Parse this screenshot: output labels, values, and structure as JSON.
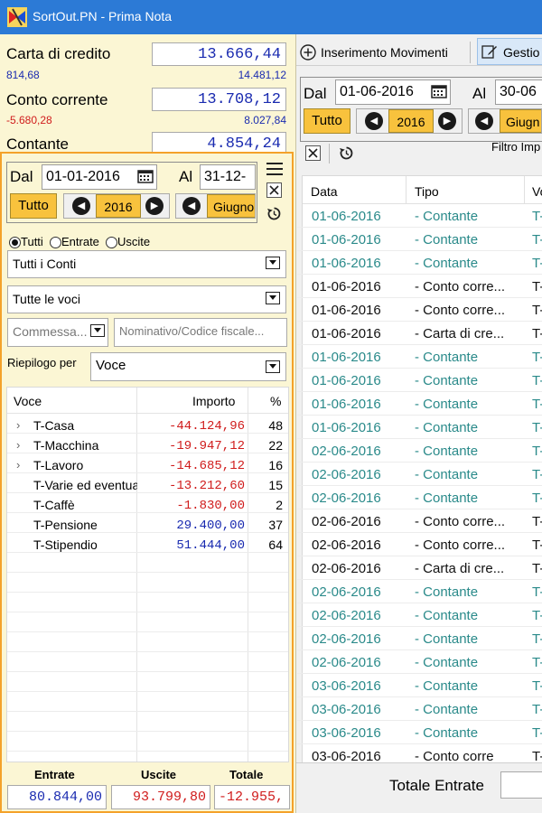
{
  "window": {
    "title": "SortOut.PN - Prima Nota"
  },
  "balances": [
    {
      "label": "Carta di credito",
      "amount": "13.666,44",
      "left_sub": "814,68",
      "left_sub_color": "#1a2bb0",
      "right_sub": "14.481,12"
    },
    {
      "label": "Conto corrente",
      "amount": "13.708,12",
      "left_sub": "-5.680,28",
      "left_sub_color": "#d01c1c",
      "right_sub": "8.027,84"
    },
    {
      "label": "Contante",
      "amount": "4.854,24"
    }
  ],
  "filter": {
    "dal_label": "Dal",
    "dal_value": "01-01-2016",
    "al_label": "Al",
    "al_value": "31-12-",
    "tutto_label": "Tutto",
    "year": "2016",
    "month": "Giugno",
    "radios": [
      "Tutti",
      "Entrate",
      "Uscite"
    ],
    "conti_value": "Tutti i Conti",
    "voci_value": "Tutte le voci",
    "commessa_placeholder": "Commessa...",
    "nominativo_placeholder": "Nominativo/Codice fiscale...",
    "riepilogo_label": "Riepilogo per",
    "riepilogo_value": "Voce"
  },
  "summary": {
    "headers": [
      "Voce",
      "Importo",
      "%"
    ],
    "rows": [
      {
        "name": "T-Casa",
        "amount": "-44.124,96",
        "pct": "48",
        "expand": true,
        "color": "#d01c1c"
      },
      {
        "name": "T-Macchina",
        "amount": "-19.947,12",
        "pct": "22",
        "expand": true,
        "color": "#d01c1c"
      },
      {
        "name": "T-Lavoro",
        "amount": "-14.685,12",
        "pct": "16",
        "expand": true,
        "color": "#d01c1c"
      },
      {
        "name": "T-Varie ed eventuali",
        "amount": "-13.212,60",
        "pct": "15",
        "expand": false,
        "color": "#d01c1c"
      },
      {
        "name": "T-Caffè",
        "amount": "-1.830,00",
        "pct": "2",
        "expand": false,
        "color": "#d01c1c"
      },
      {
        "name": "T-Pensione",
        "amount": "29.400,00",
        "pct": "37",
        "expand": false,
        "color": "#1a2bb0"
      },
      {
        "name": "T-Stipendio",
        "amount": "51.444,00",
        "pct": "64",
        "expand": false,
        "color": "#1a2bb0"
      }
    ],
    "totals_headers": [
      "Entrate",
      "Uscite",
      "Totale"
    ],
    "totals_values": [
      "80.844,00",
      "93.799,80",
      "-12.955,"
    ]
  },
  "right": {
    "tabs": [
      "Inserimento Movimenti",
      "Gestio"
    ],
    "dal_label": "Dal",
    "dal_value": "01-06-2016",
    "al_label": "Al",
    "al_value": "30-06",
    "tutto_label": "Tutto",
    "year": "2016",
    "month": "Giugn",
    "filtro_label": "Filtro Imp",
    "headers": [
      "Data",
      "Tipo",
      "Vo"
    ],
    "rows": [
      {
        "date": "01-06-2016",
        "tipo": "- Contante",
        "v": "T-",
        "color": "#2a8a8a"
      },
      {
        "date": "01-06-2016",
        "tipo": "- Contante",
        "v": "T-",
        "color": "#2a8a8a"
      },
      {
        "date": "01-06-2016",
        "tipo": "- Contante",
        "v": "T-",
        "color": "#2a8a8a"
      },
      {
        "date": "01-06-2016",
        "tipo": "- Conto corre...",
        "v": "T-",
        "color": "#111111"
      },
      {
        "date": "01-06-2016",
        "tipo": "- Conto corre...",
        "v": "T-",
        "color": "#111111"
      },
      {
        "date": "01-06-2016",
        "tipo": "- Carta di cre...",
        "v": "T-",
        "color": "#111111"
      },
      {
        "date": "01-06-2016",
        "tipo": "- Contante",
        "v": "T-",
        "color": "#2a8a8a"
      },
      {
        "date": "01-06-2016",
        "tipo": "- Contante",
        "v": "T-",
        "color": "#2a8a8a"
      },
      {
        "date": "01-06-2016",
        "tipo": "- Contante",
        "v": "T-",
        "color": "#2a8a8a"
      },
      {
        "date": "01-06-2016",
        "tipo": "- Contante",
        "v": "T-",
        "color": "#2a8a8a"
      },
      {
        "date": "02-06-2016",
        "tipo": "- Contante",
        "v": "T-",
        "color": "#2a8a8a"
      },
      {
        "date": "02-06-2016",
        "tipo": "- Contante",
        "v": "T-",
        "color": "#2a8a8a"
      },
      {
        "date": "02-06-2016",
        "tipo": "- Contante",
        "v": "T-",
        "color": "#2a8a8a"
      },
      {
        "date": "02-06-2016",
        "tipo": "- Conto corre...",
        "v": "T-",
        "color": "#111111"
      },
      {
        "date": "02-06-2016",
        "tipo": "- Conto corre...",
        "v": "T-",
        "color": "#111111"
      },
      {
        "date": "02-06-2016",
        "tipo": "- Carta di cre...",
        "v": "T-",
        "color": "#111111"
      },
      {
        "date": "02-06-2016",
        "tipo": "- Contante",
        "v": "T-",
        "color": "#2a8a8a"
      },
      {
        "date": "02-06-2016",
        "tipo": "- Contante",
        "v": "T-",
        "color": "#2a8a8a"
      },
      {
        "date": "02-06-2016",
        "tipo": "- Contante",
        "v": "T-",
        "color": "#2a8a8a"
      },
      {
        "date": "02-06-2016",
        "tipo": "- Contante",
        "v": "T-",
        "color": "#2a8a8a"
      },
      {
        "date": "03-06-2016",
        "tipo": "- Contante",
        "v": "T-",
        "color": "#2a8a8a"
      },
      {
        "date": "03-06-2016",
        "tipo": "- Contante",
        "v": "T-",
        "color": "#2a8a8a"
      },
      {
        "date": "03-06-2016",
        "tipo": "- Contante",
        "v": "T-",
        "color": "#2a8a8a"
      },
      {
        "date": "03-06-2016",
        "tipo": "- Conto corre",
        "v": "T-",
        "color": "#111111"
      }
    ],
    "totale_entrate_label": "Totale Entrate"
  },
  "colors": {
    "accent_orange": "#f4a22a",
    "year_button": "#f8c23d",
    "panel_bg": "#fbf6d4",
    "titlebar": "#2c7ad6"
  },
  "icons": [
    "app-logo",
    "calendar-icon",
    "menu-icon",
    "close-icon",
    "reset-icon",
    "chevron-left-icon",
    "chevron-right-icon",
    "dropdown-icon",
    "plus-icon",
    "edit-icon"
  ]
}
